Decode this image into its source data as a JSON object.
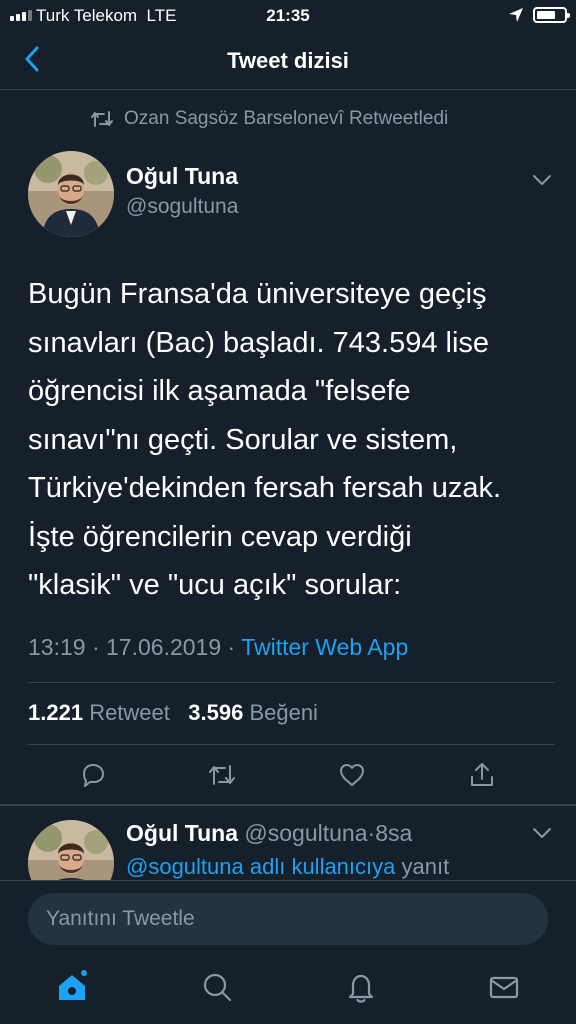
{
  "status_bar": {
    "carrier": "Turk Telekom",
    "network": "LTE",
    "time": "21:35",
    "battery_level": 0.7
  },
  "nav": {
    "title": "Tweet dizisi",
    "back_icon": "chevron-left-icon"
  },
  "retweet_context": {
    "text": "Ozan Sagsöz Barselonevî Retweetledi",
    "icon": "retweet-icon"
  },
  "tweet": {
    "author_name": "Oğul Tuna",
    "author_handle": "@sogultuna",
    "text": "Bugün Fransa'da üniversiteye geçiş\nsınavları (Bac) başladı. 743.594 lise\nöğrencisi ilk aşamada \"felsefe\nsınavı\"nı geçti. Sorular ve sistem,\nTürkiye'dekinden fersah fersah uzak.\nİşte öğrencilerin cevap verdiği\n\"klasik\" ve \"ucu açık\" sorular:",
    "time": "13:19",
    "date": "17.06.2019",
    "separator": "·",
    "source": "Twitter Web App",
    "retweet_count": "1.221",
    "retweet_label": "Retweet",
    "like_count": "3.596",
    "like_label": "Beğeni"
  },
  "actions": [
    {
      "name": "reply",
      "icon": "reply-icon"
    },
    {
      "name": "retweet",
      "icon": "retweet-icon"
    },
    {
      "name": "like",
      "icon": "heart-icon"
    },
    {
      "name": "share",
      "icon": "share-icon"
    }
  ],
  "reply_tweet": {
    "author_name": "Oğul Tuna",
    "author_handle": "@sogultuna",
    "separator": "·",
    "age": "8sa",
    "reply_to_link": "@sogultuna adlı kullanıcıya",
    "reply_to_suffix": "yanıt"
  },
  "composer": {
    "placeholder": "Yanıtını Tweetle"
  },
  "tabbar": [
    {
      "name": "home",
      "icon": "home-icon",
      "active": true
    },
    {
      "name": "search",
      "icon": "search-icon"
    },
    {
      "name": "notifications",
      "icon": "bell-icon"
    },
    {
      "name": "messages",
      "icon": "mail-icon"
    }
  ],
  "colors": {
    "background": "#15202b",
    "accent": "#1da1f2",
    "secondary_text": "#8899a6",
    "divider": "#38444d"
  }
}
